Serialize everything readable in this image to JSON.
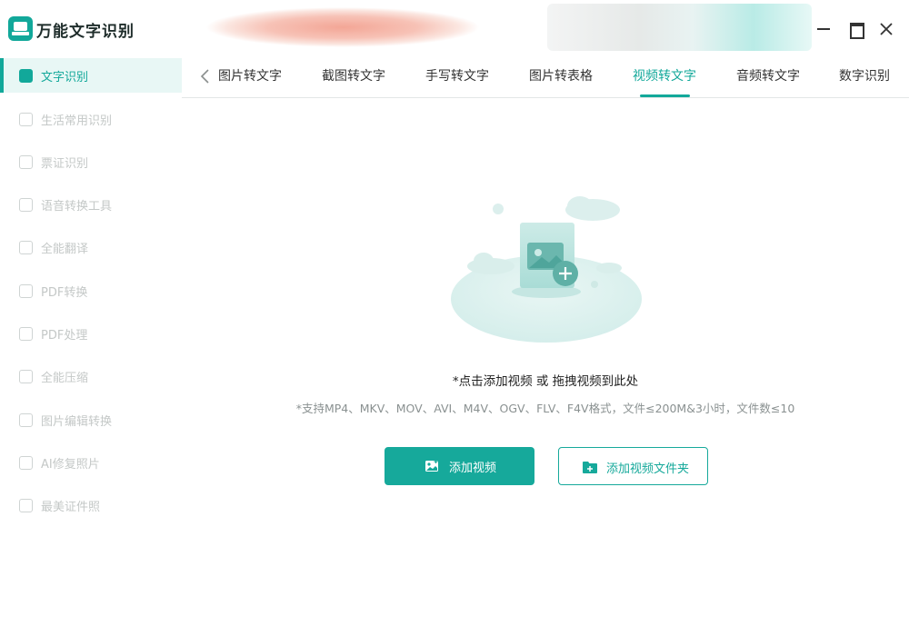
{
  "app": {
    "title": "万能文字识别"
  },
  "window_controls": {
    "minimize_icon": "minimize-icon",
    "maximize_icon": "maximize-icon",
    "close_icon": "close-icon"
  },
  "sidebar": {
    "items": [
      {
        "label": "文字识别",
        "active": true,
        "icon": "text-scan-icon"
      },
      {
        "label": "生活常用识别",
        "active": false,
        "icon": "scan-icon"
      },
      {
        "label": "票证识别",
        "active": false,
        "icon": "ticket-scan-icon"
      },
      {
        "label": "语音转换工具",
        "active": false,
        "icon": "voice-convert-icon"
      },
      {
        "label": "全能翻译",
        "active": false,
        "icon": "translate-icon"
      },
      {
        "label": "PDF转换",
        "active": false,
        "icon": "pdf-convert-icon"
      },
      {
        "label": "PDF处理",
        "active": false,
        "icon": "pdf-process-icon"
      },
      {
        "label": "全能压缩",
        "active": false,
        "icon": "compress-icon"
      },
      {
        "label": "图片编辑转换",
        "active": false,
        "icon": "image-edit-icon"
      },
      {
        "label": "AI修复照片",
        "active": false,
        "icon": "ai-repair-icon"
      },
      {
        "label": "最美证件照",
        "active": false,
        "icon": "id-photo-icon"
      }
    ]
  },
  "tabs": {
    "back_icon": "chevron-left-icon",
    "items": [
      {
        "label": "图片转文字",
        "active": false
      },
      {
        "label": "截图转文字",
        "active": false
      },
      {
        "label": "手写转文字",
        "active": false
      },
      {
        "label": "图片转表格",
        "active": false
      },
      {
        "label": "视频转文字",
        "active": true
      },
      {
        "label": "音频转文字",
        "active": false
      },
      {
        "label": "数字识别",
        "active": false
      }
    ]
  },
  "main": {
    "illustration": "video-upload-illustration",
    "hint": "*点击添加视频 或 拖拽视频到此处",
    "support_text": "*支持MP4、MKV、MOV、AVI、M4V、OGV、FLV、F4V格式，文件≤200M&3小时，文件数≤10",
    "add_video_button": "添加视频",
    "add_folder_button": "添加视频文件夹"
  },
  "colors": {
    "accent": "#16a99b",
    "sidebar_active_bg": "#e8f7f5",
    "muted_text": "#c4c8c7"
  }
}
